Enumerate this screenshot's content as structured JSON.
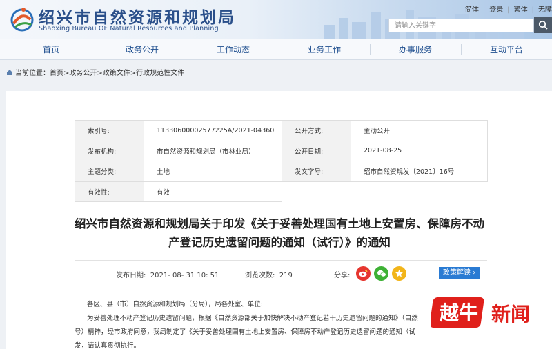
{
  "header": {
    "site_title": "绍兴市自然资源和规划局",
    "site_subtitle": "Shaoxing Bureau OF Natural Resources and Planning",
    "top_links": [
      "简体",
      "登录",
      "繁体",
      "无障"
    ],
    "search_placeholder": "请输入关键字"
  },
  "nav": {
    "items": [
      "首页",
      "政务公开",
      "工作动态",
      "业务工作",
      "办事服务",
      "互动平台"
    ]
  },
  "breadcrumb": {
    "text": "当前位置：首页>政务公开>政策文件>行政规范性文件"
  },
  "meta_table": {
    "index_label": "索引号:",
    "index_value": "11330600002577225A/2021-04360",
    "publicity_label": "公开方式:",
    "publicity_value": "主动公开",
    "agency_label": "发布机构:",
    "agency_value": "市自然资源和规划局（市林业局）",
    "pubdate_label": "公开日期:",
    "pubdate_value": "2021-08-25",
    "topic_label": "主题分类:",
    "topic_value": "土地",
    "docno_label": "发文字号:",
    "docno_value": "绍市自然资规发〔2021〕16号",
    "validity_label": "有效性:",
    "validity_value": "有效"
  },
  "document": {
    "title_line1": "绍兴市自然资源和规划局关于印发《关于妥善处理国有土地上安置房、保障房不动",
    "title_line2": "产登记历史遗留问题的通知（试行）》的通知",
    "publish_label": "发布日期:",
    "publish_value": "2021- 08- 31 10: 51",
    "views_label": "浏览次数:",
    "views_value": "219",
    "share_label": "分享:",
    "policy_button": "政策解读",
    "body_lines": [
      "各区、县（市）自然资源和规划局（分局），局各处室、单位:",
      "为妥善处理不动产登记历史遗留问题，根据《自然资源部关于加快解决不动产登记若干历史遗留问题的通知》（自然",
      "号）精神，经市政府同意，我局制定了《关于妥善处理国有土地上安置房、保障房不动产登记历史遗留问题的通知（试",
      "发，请认真贯彻执行。"
    ]
  },
  "watermark": {
    "text": "越牛新闻"
  },
  "colors": {
    "nav_text": "#1f4f8f",
    "accent": "#2a7bd3",
    "watermark": "#e0201b"
  }
}
